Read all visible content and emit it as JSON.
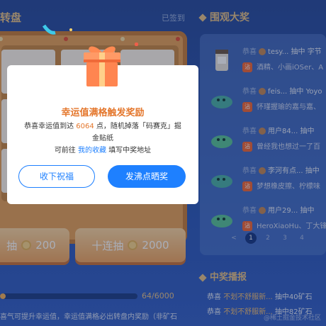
{
  "lottery": {
    "title": "转盘",
    "signed_label": "已签到",
    "single_draw": {
      "label": "抽",
      "cost": "200"
    },
    "ten_draw": {
      "label": "十连抽",
      "cost": "2000"
    },
    "progress": {
      "text": "64/6000",
      "value": 64,
      "max": 6000
    },
    "note": "喜气可提升幸运值，幸运值满格必出转盘内奖励（非矿石"
  },
  "winners": {
    "title": "围观大奖",
    "rows": [
      {
        "prefix": "恭喜",
        "user": "tesy...",
        "action": "抽中",
        "prize": "字节",
        "comment": "酒精、小画iOSer、A"
      },
      {
        "prefix": "恭喜",
        "user": "feis...",
        "action": "抽中",
        "prize": "Yoyo",
        "comment": "怀瑾握瑜的嘉与嘉、"
      },
      {
        "prefix": "恭喜",
        "user": "用户84...",
        "action": "抽中",
        "prize": "",
        "comment": "曾经我也想过一了百"
      },
      {
        "prefix": "恭喜",
        "user": "李河有点...",
        "action": "抽中",
        "prize": "",
        "comment": "梦想橡皮擦、柠檬味"
      },
      {
        "prefix": "恭喜",
        "user": "用户29...",
        "action": "抽中",
        "prize": "",
        "comment": "HeroXiaoHu、丁大锋"
      }
    ],
    "tag": "沾",
    "pages": [
      "<",
      "1",
      "2",
      "3",
      "4"
    ]
  },
  "report": {
    "title": "中奖播报",
    "rows": [
      {
        "prefix": "恭喜",
        "user": "不划不舒服新...",
        "action": "抽中40矿石"
      },
      {
        "prefix": "恭喜",
        "user": "不划不舒服新...",
        "action": "抽中82矿石"
      }
    ]
  },
  "modal": {
    "title": "幸运值满格触发奖励",
    "desc_prefix": "恭喜幸运值到达",
    "desc_num": "6064",
    "desc_suffix": "点，随机掉落「码赛克」掘金贴纸",
    "desc2_prefix": "可前往",
    "desc2_link": "我的收藏",
    "desc2_suffix": "填写中奖地址",
    "btn_secondary": "收下祝福",
    "btn_primary": "发沸点晒奖"
  },
  "watermark": "@稀土掘金技术社区",
  "colors": {
    "accent": "#1e80ff",
    "orange": "#e4762b",
    "gold": "#e7c48a"
  }
}
